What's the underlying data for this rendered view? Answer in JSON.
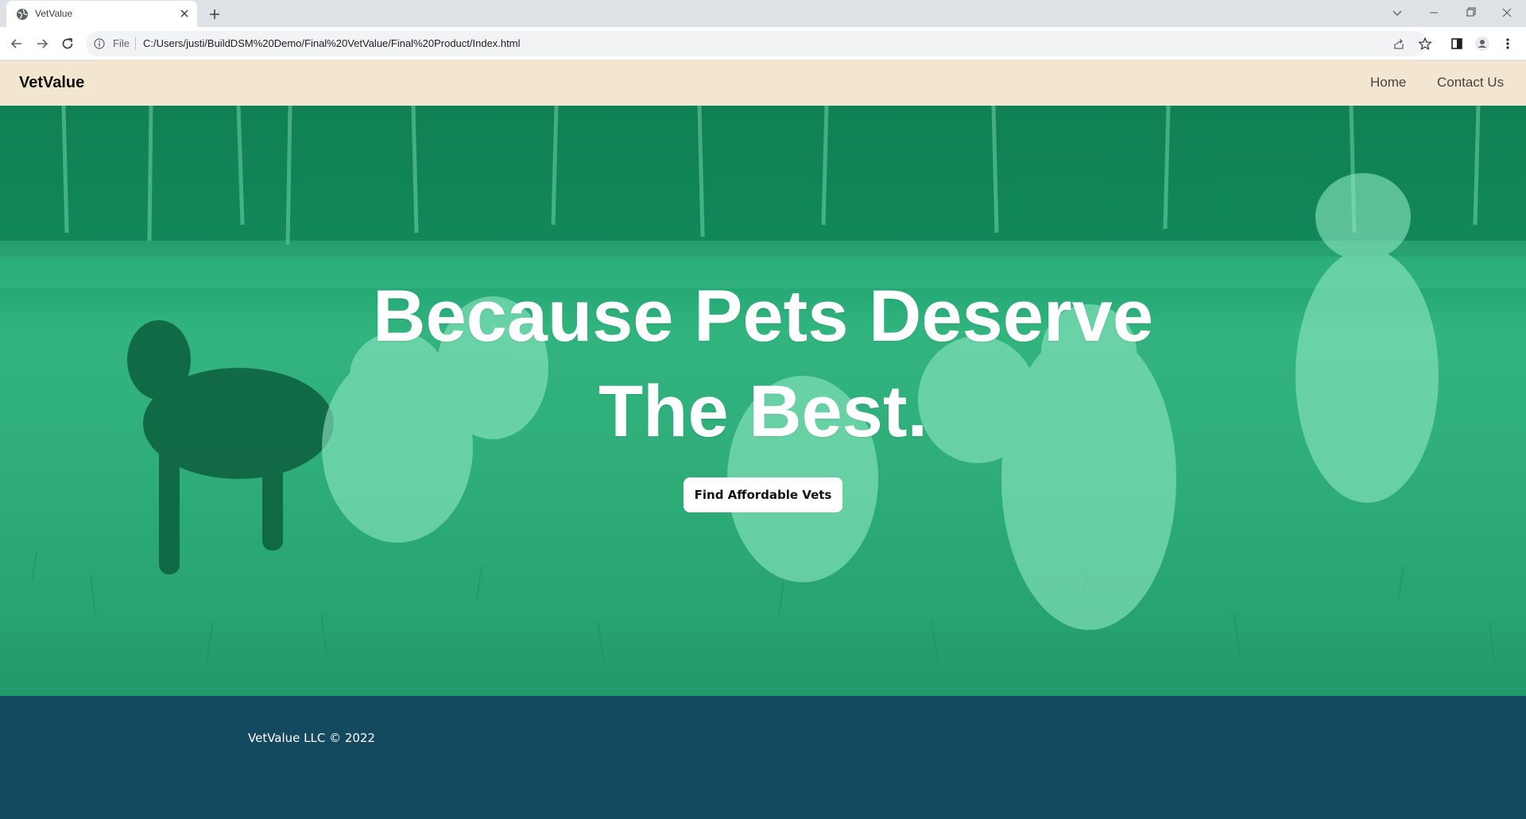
{
  "browser": {
    "tab_title": "VetValue",
    "file_label": "File",
    "url": "C:/Users/justi/BuildDSM%20Demo/Final%20VetValue/Final%20Product/Index.html"
  },
  "nav": {
    "brand": "VetValue",
    "links": [
      "Home",
      "Contact Us"
    ]
  },
  "hero": {
    "title_line1": "Because Pets Deserve",
    "title_line2": "The Best.",
    "cta_label": "Find Affordable Vets"
  },
  "footer": {
    "copyright": "VetValue LLC © 2022"
  },
  "colors": {
    "nav_bg": "#f3e6d1",
    "hero_tint": "#2fb07c",
    "footer_bg": "#134a60"
  }
}
